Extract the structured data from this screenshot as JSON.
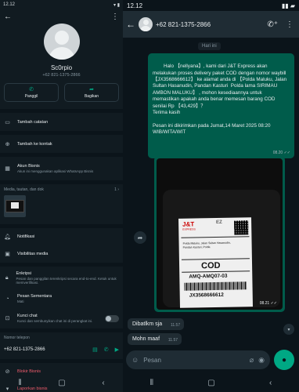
{
  "left": {
    "status_time": "12.12",
    "profile_name": "Sc0rpio",
    "profile_phone": "+62 821-1375-2866",
    "actions": [
      {
        "label": "Panggil",
        "icon": "phone-icon"
      },
      {
        "label": "Bagikan",
        "icon": "share-icon"
      }
    ],
    "add_note": "Tambah catatan",
    "add_contact": "Tambah ke kontak",
    "business_title": "Akun Bisnis",
    "business_sub": "Akun ini menggunakan aplikasi WhatsApp Bisnis",
    "media_label": "Media, tautan, dan dok",
    "media_count": "1",
    "notifications": "Notifikasi",
    "media_visibility": "Visibilitas media",
    "encryption_title": "Enkripsi",
    "encryption_sub": "Pesan dan panggilan terenkripsi secara end-to-end. Ketuk untuk memverifikasi.",
    "disappearing_title": "Pesan Sementara",
    "disappearing_sub": "Mati",
    "chat_lock_title": "Kunci chat",
    "chat_lock_sub": "Kunci dan sembunyikan chat ini di perangkat ini.",
    "phone_section_label": "Nomor telepon",
    "phone_number": "+62 821-1375-2866",
    "block": "Blokir Bisnis",
    "report": "Laporkan bisnis"
  },
  "chat": {
    "status_time": "12.12",
    "title": "+62 821-1375-2866",
    "date_pill": "Hari ini",
    "outgoing_text": "Halo 【nellyana】, kami dari J&T Express akan melakukan proses delivery paket COD dengan nomor waybill 【JX3568666612】 ke alamat anda di 【Polda Maluku, Jalan Sultan Hasanudin, Pandan Kasturi  Polda lama SIRIMAU AMBON MALUKU】 , mohon kesediaannya untuk memastikan apakah anda benar memesan barang COD senilai Rp 【43,429】？\nTerima kasih\n\nPesan ini dikirimkan pada Jumat,14 Maret 2025 08:20 WIB/WITA/WIT",
    "outgoing_time": "08.20",
    "image_time": "08.21",
    "waybill": {
      "brand": "J&T",
      "brand_sub": "EXPRESS",
      "ez": "EZ",
      "address": "Polda Maluku, Jalan Sultan Hasanudin, Pandan Kasturi, Polda",
      "cod": "COD",
      "route": "AMQ-AMQ07-03",
      "waybill_no": "JX3568666612"
    },
    "incoming": [
      {
        "text": "Dibatlkm sja",
        "time": "11.57"
      },
      {
        "text": "Mohn maaf",
        "time": "11.57"
      }
    ],
    "composer_placeholder": "Pesan"
  },
  "colors": {
    "accent": "#00a884",
    "outgoing_bubble": "#005c4b",
    "incoming_bubble": "#202c33",
    "danger": "#f15c6d"
  }
}
